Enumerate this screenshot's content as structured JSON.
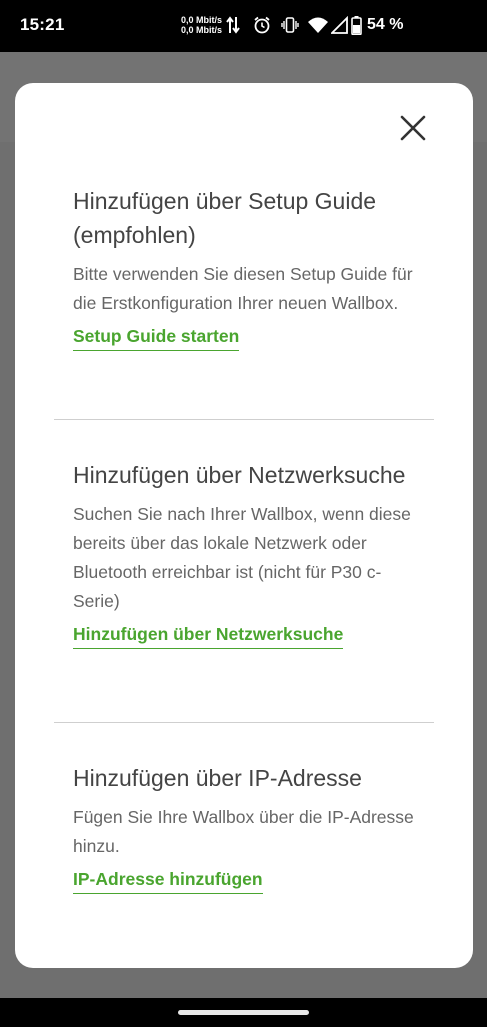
{
  "status_bar": {
    "time": "15:21",
    "net_up": "0,0 Mbit/s",
    "net_down": "0,0 Mbit/s",
    "battery": "54 %",
    "icons": [
      "data-arrows-icon",
      "alarm-icon",
      "vibrate-icon",
      "wifi-icon",
      "signal-icon",
      "battery-icon"
    ]
  },
  "dialog": {
    "close_icon": "close-icon",
    "sections": [
      {
        "title": "Hinzufügen über Setup Guide (empfohlen)",
        "description": "Bitte verwenden Sie diesen Setup Guide für die Erstkonfiguration Ihrer neuen Wallbox.",
        "link": "Setup Guide starten"
      },
      {
        "title": "Hinzufügen über Netzwerksuche",
        "description": "Suchen Sie nach Ihrer Wallbox, wenn diese bereits über das lokale Netzwerk oder Bluetooth erreichbar ist (nicht für P30 c-Serie)",
        "link": "Hinzufügen über Netzwerksuche"
      },
      {
        "title": "Hinzufügen über IP-Adresse",
        "description": "Fügen Sie Ihre Wallbox über die IP-Adresse hinzu.",
        "link": "IP-Adresse hinzufügen"
      }
    ]
  },
  "colors": {
    "accent": "#4aa52f",
    "title": "#444444",
    "text": "#666666",
    "scrim": "#6f6f6f"
  }
}
